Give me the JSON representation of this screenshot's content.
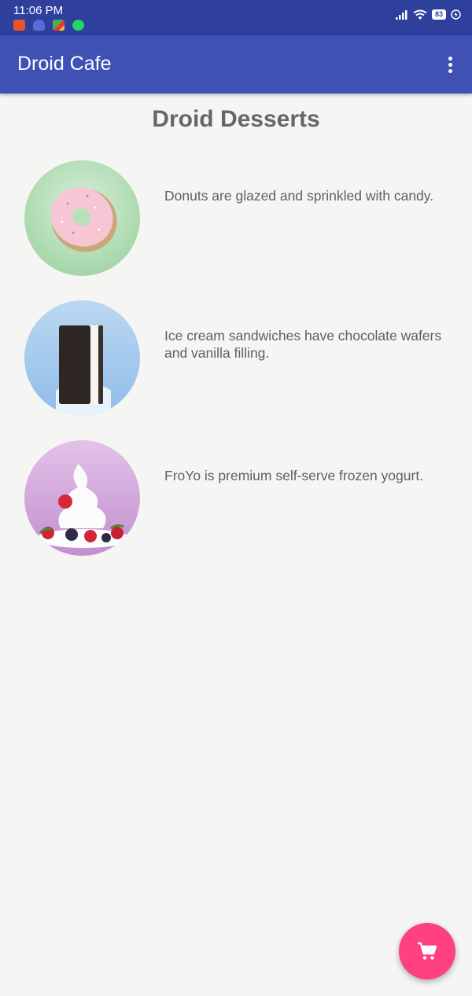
{
  "status_bar": {
    "time": "11:06 PM",
    "battery": "83",
    "notification_icons": [
      "screen-recorder-icon",
      "android-icon",
      "app-icon",
      "whatsapp-icon"
    ]
  },
  "app_bar": {
    "title": "Droid Cafe",
    "overflow_icon": "more-vert-icon"
  },
  "page": {
    "title": "Droid Desserts"
  },
  "desserts": [
    {
      "name": "donut",
      "description": "Donuts are glazed and sprinkled with candy."
    },
    {
      "name": "ice-cream-sandwich",
      "description": "Ice cream sandwiches have chocolate wafers and vanilla filling."
    },
    {
      "name": "froyo",
      "description": "FroYo is premium self-serve frozen yogurt."
    }
  ],
  "fab": {
    "icon": "shopping-cart-icon"
  },
  "colors": {
    "status_bar": "#2e3f9c",
    "app_bar": "#3f51b5",
    "fab": "#ff4081",
    "background": "#f5f6f4"
  }
}
